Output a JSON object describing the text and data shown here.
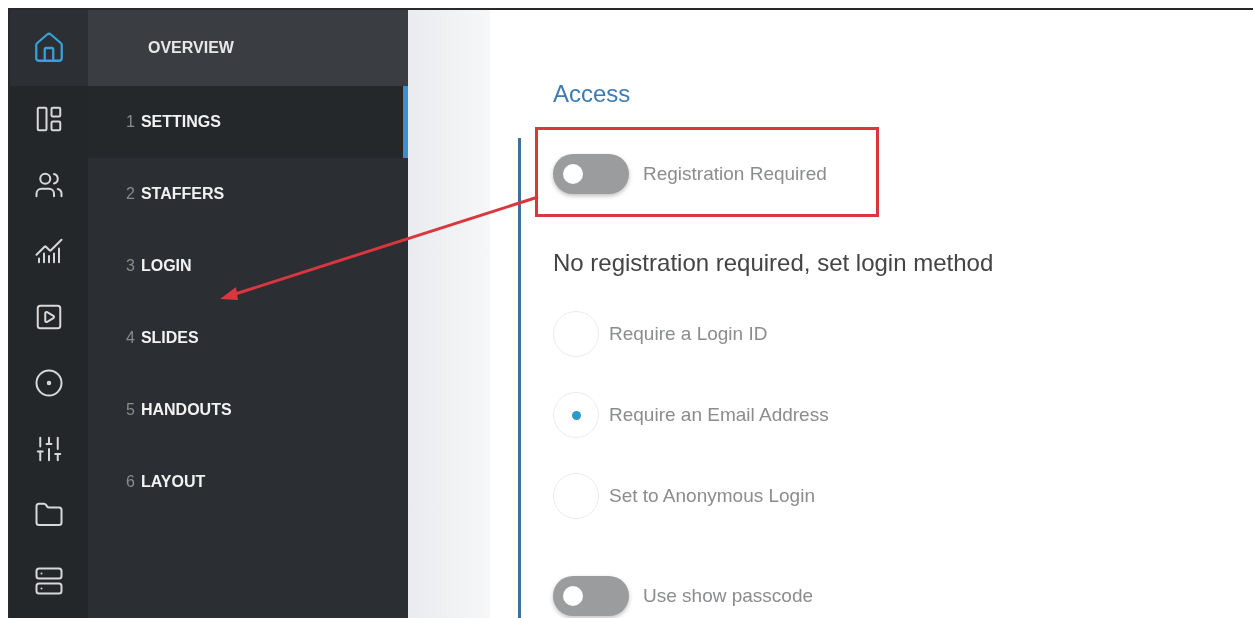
{
  "rail": {
    "items": [
      {
        "kind": "home",
        "selected": true
      },
      {
        "kind": "layout",
        "selected": false
      },
      {
        "kind": "people",
        "selected": false
      },
      {
        "kind": "chart",
        "selected": false
      },
      {
        "kind": "media",
        "selected": false
      },
      {
        "kind": "video",
        "selected": false
      },
      {
        "kind": "sliders",
        "selected": false
      },
      {
        "kind": "folder",
        "selected": false
      },
      {
        "kind": "stack",
        "selected": false
      }
    ]
  },
  "nav": {
    "header": "OVERVIEW",
    "items": [
      {
        "number": "1",
        "label": "SETTINGS",
        "selected": true
      },
      {
        "number": "2",
        "label": "STAFFERS",
        "selected": false
      },
      {
        "number": "3",
        "label": "LOGIN",
        "selected": false
      },
      {
        "number": "4",
        "label": "SLIDES",
        "selected": false
      },
      {
        "number": "5",
        "label": "HANDOUTS",
        "selected": false
      },
      {
        "number": "6",
        "label": "LAYOUT",
        "selected": false
      }
    ]
  },
  "content": {
    "title": "Access",
    "registration_toggle": {
      "label": "Registration Required",
      "on": false,
      "highlighted": true
    },
    "login_heading": "No registration required, set login method",
    "login_options": [
      {
        "label": "Require a Login ID",
        "selected": false
      },
      {
        "label": "Require an Email Address",
        "selected": true
      },
      {
        "label": "Set to Anonymous Login",
        "selected": false
      }
    ],
    "passcode_toggle": {
      "label": "Use show passcode",
      "on": false
    }
  }
}
